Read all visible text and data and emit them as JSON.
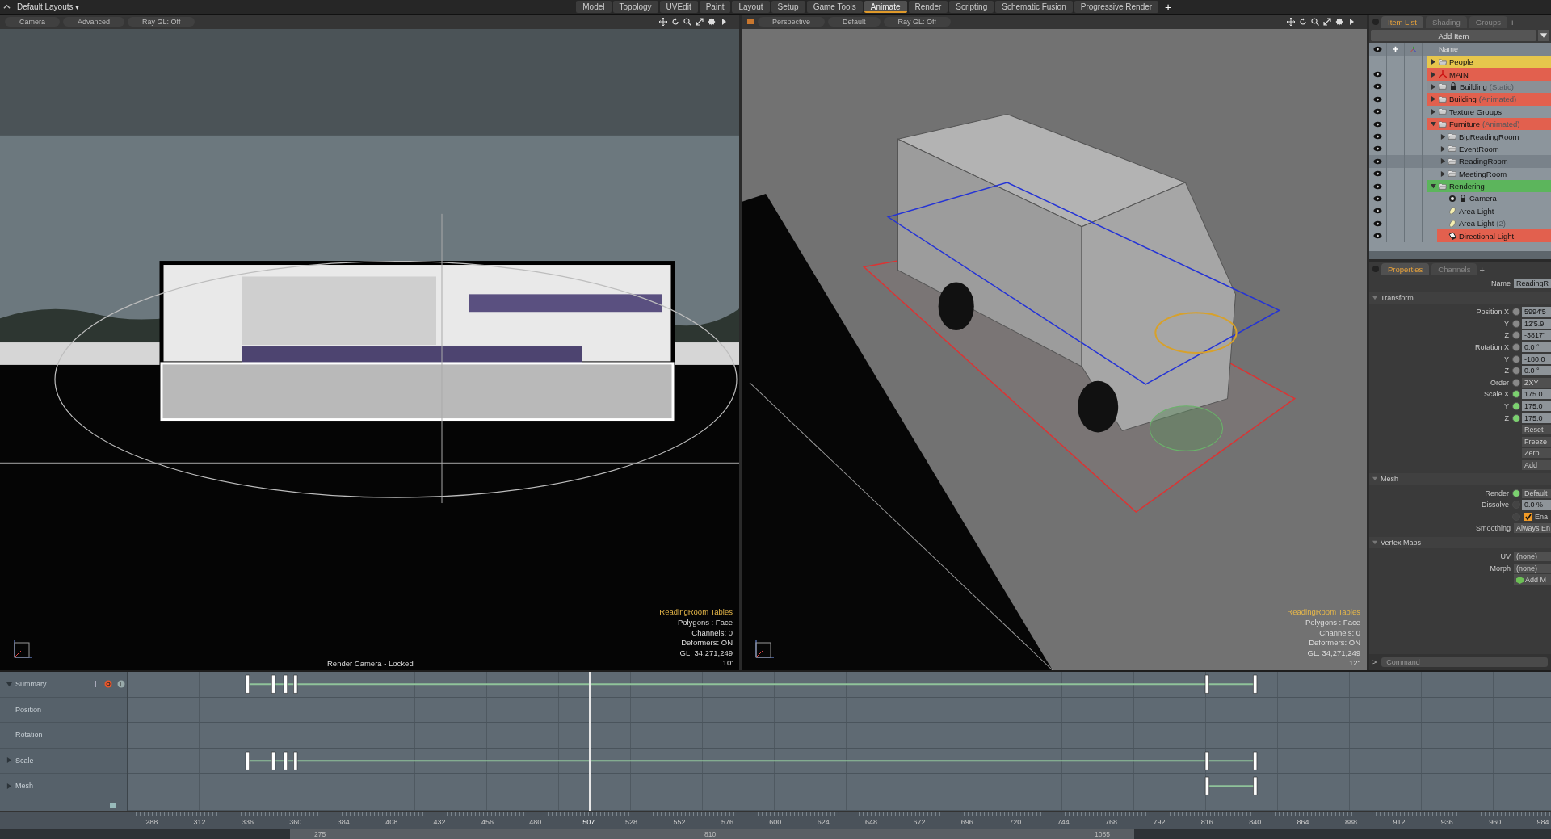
{
  "menu": {
    "layout": "Default Layouts",
    "layout_caret": "▾",
    "add": "+",
    "tabs": [
      {
        "label": "Model",
        "selected": false
      },
      {
        "label": "Topology",
        "selected": false
      },
      {
        "label": "UVEdit",
        "selected": false
      },
      {
        "label": "Paint",
        "selected": false
      },
      {
        "label": "Layout",
        "selected": false
      },
      {
        "label": "Setup",
        "selected": false
      },
      {
        "label": "Game Tools",
        "selected": false
      },
      {
        "label": "Animate",
        "selected": true
      },
      {
        "label": "Render",
        "selected": false
      },
      {
        "label": "Scripting",
        "selected": false
      },
      {
        "label": "Schematic Fusion",
        "selected": false
      },
      {
        "label": "Progressive Render",
        "selected": false
      }
    ]
  },
  "viewports": [
    {
      "kind": "camera",
      "buttons": [
        "Camera",
        "Advanced",
        "Ray GL: Off"
      ],
      "info_title": "ReadingRoom Tables",
      "info": [
        "Polygons : Face",
        "Channels: 0",
        "Deformers: ON",
        "GL: 34,271,249",
        "10'"
      ],
      "caption": "Render Camera - Locked"
    },
    {
      "kind": "perspective",
      "buttons": [
        "Perspective",
        "Default",
        "Ray GL: Off"
      ],
      "info_title": "ReadingRoom Tables",
      "info": [
        "Polygons : Face",
        "Channels: 0",
        "Deformers: ON",
        "GL: 34,271,249",
        "12\""
      ]
    }
  ],
  "item_list": {
    "tabs": [
      {
        "label": "Item List",
        "selected": true
      },
      {
        "label": "Shading",
        "selected": false
      },
      {
        "label": "Groups",
        "selected": false
      }
    ],
    "add_tab": "+",
    "add_item": "Add Item",
    "name_header": "Name",
    "items": [
      {
        "kind": "group",
        "name": "People",
        "color": "#e6c64c",
        "visible": false,
        "expanded": false,
        "selected": false
      },
      {
        "kind": "locator",
        "name": "MAIN",
        "color": "#e2604e",
        "visible": true,
        "expanded": false,
        "selected": false
      },
      {
        "kind": "group",
        "name": "Building",
        "note": "(Static)",
        "locked": true,
        "color": "#8b9096",
        "visible": true,
        "expanded": false,
        "selected": false
      },
      {
        "kind": "group",
        "name": "Building",
        "note": "(Animated)",
        "color": "#e2604e",
        "visible": true,
        "expanded": false,
        "selected": false
      },
      {
        "kind": "group",
        "name": "Texture Groups",
        "visible": true,
        "expanded": false,
        "selected": false
      },
      {
        "kind": "group",
        "name": "Furniture",
        "note": "(Animated)",
        "color": "#e2604e",
        "visible": true,
        "expanded": true,
        "selected": false,
        "children": [
          {
            "kind": "group",
            "name": "BigReadingRoom",
            "visible": true,
            "expanded": false,
            "selected": false
          },
          {
            "kind": "group",
            "name": "EventRoom",
            "visible": true,
            "expanded": false,
            "selected": false
          },
          {
            "kind": "group",
            "name": "ReadingRoom",
            "visible": true,
            "expanded": false,
            "selected": true
          },
          {
            "kind": "group",
            "name": "MeetingRoom",
            "visible": true,
            "expanded": false,
            "selected": false
          }
        ]
      },
      {
        "kind": "group",
        "name": "Rendering",
        "color": "#5cb55c",
        "visible": true,
        "expanded": true,
        "selected": false,
        "children": [
          {
            "kind": "camera",
            "name": "Camera",
            "locked": true,
            "visible": true,
            "selected": false
          },
          {
            "kind": "light",
            "name": "Area Light",
            "visible": true,
            "selected": false
          },
          {
            "kind": "light",
            "name": "Area Light",
            "note": "(2)",
            "visible": true,
            "selected": false
          },
          {
            "kind": "sun",
            "name": "Directional Light",
            "color": "#e2604e",
            "visible": true,
            "selected": false
          }
        ]
      }
    ]
  },
  "properties": {
    "tabs": [
      {
        "label": "Properties",
        "selected": true
      },
      {
        "label": "Channels",
        "selected": false
      }
    ],
    "add_tab": "+",
    "name_label": "Name",
    "name_value": "ReadingR",
    "sections": [
      {
        "title": "Transform",
        "rows": [
          {
            "kind": "field",
            "label": "Position X",
            "keyed": false,
            "disabled": false,
            "value": "5994'5"
          },
          {
            "kind": "field",
            "label": "Y",
            "keyed": false,
            "disabled": false,
            "value": "12'5.9"
          },
          {
            "kind": "field",
            "label": "Z",
            "keyed": false,
            "disabled": false,
            "value": "-3817'"
          },
          {
            "kind": "field",
            "label": "Rotation X",
            "keyed": false,
            "disabled": false,
            "value": "0.0 °"
          },
          {
            "kind": "field",
            "label": "Y",
            "keyed": false,
            "disabled": false,
            "value": "-180.0"
          },
          {
            "kind": "field",
            "label": "Z",
            "keyed": false,
            "disabled": false,
            "value": "0.0 °"
          },
          {
            "kind": "select",
            "label": "Order",
            "keyed": false,
            "disabled": false,
            "value": "ZXY"
          },
          {
            "kind": "field",
            "label": "Scale X",
            "keyed": true,
            "disabled": false,
            "value": "175.0"
          },
          {
            "kind": "field",
            "label": "Y",
            "keyed": true,
            "disabled": false,
            "value": "175.0"
          },
          {
            "kind": "field",
            "label": "Z",
            "keyed": true,
            "disabled": false,
            "value": "175.0"
          },
          {
            "kind": "button",
            "value": "Reset"
          },
          {
            "kind": "button",
            "value": "Freeze"
          },
          {
            "kind": "button",
            "value": "Zero"
          },
          {
            "kind": "button",
            "value": "Add"
          }
        ]
      },
      {
        "title": "Mesh",
        "rows": [
          {
            "kind": "select",
            "label": "Render",
            "keyed": true,
            "disabled": false,
            "value": "Default"
          },
          {
            "kind": "field",
            "label": "Dissolve",
            "keyed": false,
            "disabled": true,
            "value": "0.0 %"
          },
          {
            "kind": "check",
            "keyed": false,
            "disabled": true,
            "checked": true,
            "value": "Ena"
          },
          {
            "kind": "select",
            "label": "Smoothing",
            "value": "Always En"
          }
        ]
      },
      {
        "title": "Vertex Maps",
        "rows": [
          {
            "kind": "select",
            "label": "UV",
            "value": "(none)"
          },
          {
            "kind": "select",
            "label": "Morph",
            "value": "(none)"
          },
          {
            "kind": "action",
            "value": "Add M"
          }
        ]
      }
    ],
    "command_prompt": ">",
    "command_placeholder": "Command"
  },
  "timeline": {
    "tracks": [
      {
        "kind": "group",
        "label": "Summary",
        "expanded": true
      },
      {
        "kind": "channel",
        "label": "Position"
      },
      {
        "kind": "channel",
        "label": "Rotation"
      },
      {
        "kind": "group",
        "label": "Scale",
        "expanded": false
      },
      {
        "kind": "group",
        "label": "Mesh",
        "expanded": false
      }
    ],
    "ticks": [
      "288",
      "312",
      "336",
      "360",
      "384",
      "408",
      "432",
      "456",
      "480",
      "528",
      "552",
      "576",
      "600",
      "624",
      "648",
      "672",
      "696",
      "720",
      "744",
      "768",
      "792",
      "816",
      "840",
      "864",
      "888",
      "912",
      "936",
      "960",
      "984"
    ],
    "playhead": {
      "frame": "507",
      "level": 0.324
    },
    "range": [
      "275",
      "810",
      "1085"
    ]
  }
}
